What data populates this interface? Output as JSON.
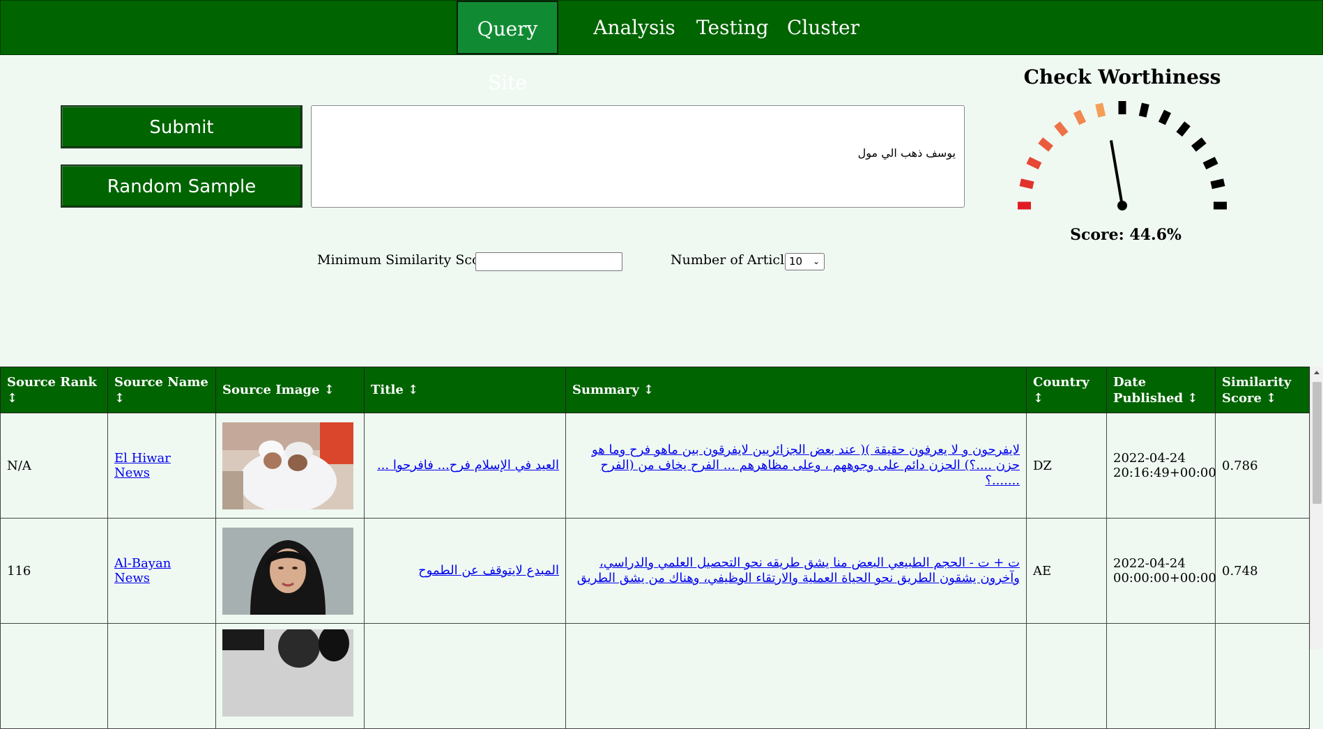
{
  "nav": {
    "items": [
      {
        "label": "Query Site",
        "active": true
      },
      {
        "label": "Analysis",
        "active": false
      },
      {
        "label": "Testing",
        "active": false
      },
      {
        "label": "Cluster",
        "active": false
      }
    ]
  },
  "actions": {
    "submit_label": "Submit",
    "random_label": "Random Sample"
  },
  "query": {
    "value": "يوسف ذهب الي مول"
  },
  "gauge": {
    "title": "Check Worthiness",
    "score_text": "Score: 44.6%",
    "score": 0.446,
    "colors": {
      "low": "#e01b24",
      "mid": "#f5a35a",
      "high": "#000000"
    }
  },
  "filters": {
    "similarity_label": "Minimum Similarity Score:",
    "similarity_value": "",
    "articles_label": "Number of Articles:",
    "articles_value": "10"
  },
  "table": {
    "headers": [
      "Source Rank ↕",
      "Source Name ↕",
      "Source Image ↕",
      "Title ↕",
      "Summary ↕",
      "Country ↕",
      "Date Published ↕",
      "Similarity Score ↕"
    ],
    "rows": [
      {
        "rank": "N/A",
        "source": "El Hiwar News",
        "image": "photo of two children in white caps embracing",
        "title": "العيد في الإسلام فرح... فافرحوا ...",
        "summary": "لايفرحون و لا يعرفون حقيقة )( عند بعض الجزائريين لايفرقون بين ماهو فرح وما هو حزن ....؟) الحزن دائم على وجوههم ، وعلى مظاهرهم ... الفرح يخاف من (الفرح .......؟",
        "country": "DZ",
        "date": "2022-04-24 20:16:49+00:00",
        "score": "0.786"
      },
      {
        "rank": "116",
        "source": "Al-Bayan News",
        "image": "portrait of a woman in a black hijab",
        "title": "المبدع لايتوقف عن الطموح",
        "summary": "ت + ت - الحجم الطبيعي البعض منا يشق طريقه نحو التحصيل العلمي والدراسي، وآخرون يشقون الطريق نحو الحياة العملية والارتقاء الوظيفي، وهناك من يشق الطريق",
        "country": "AE",
        "date": "2022-04-24 00:00:00+00:00",
        "score": "0.748"
      },
      {
        "rank": "",
        "source": "",
        "image": "partial photo",
        "title": "",
        "summary": "",
        "country": "",
        "date": "",
        "score": ""
      }
    ]
  }
}
